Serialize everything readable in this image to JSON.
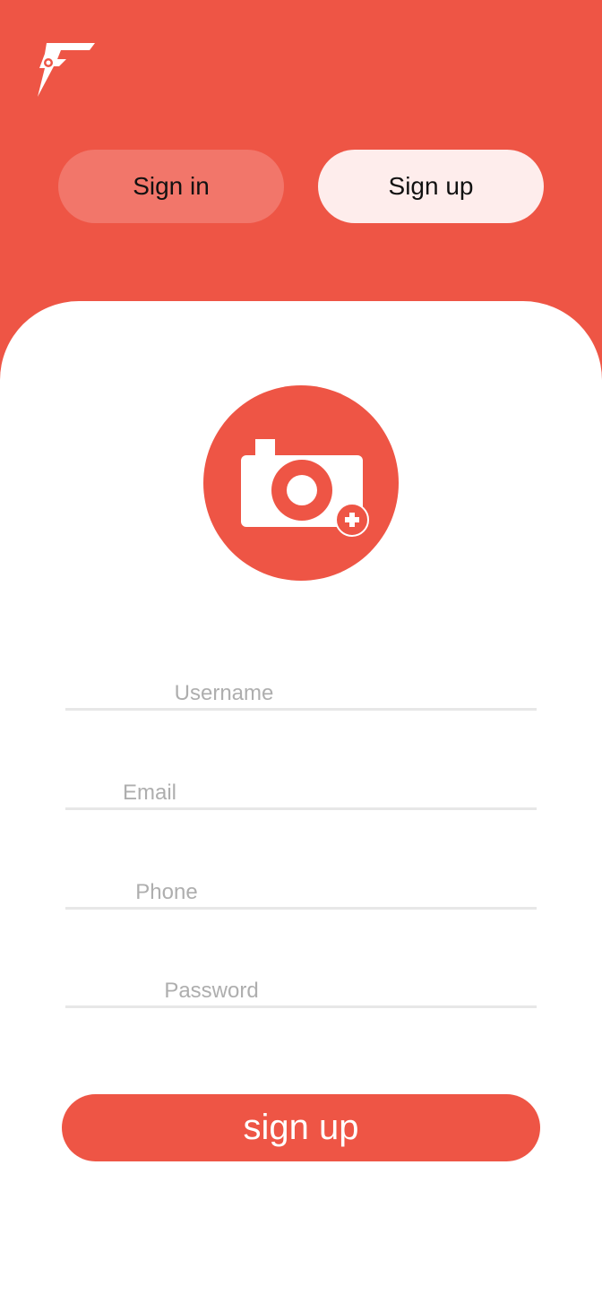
{
  "colors": {
    "brand": "#EE5545",
    "tab_inactive": "#F2766A",
    "tab_active": "#FEEDEC",
    "placeholder": "#AEAEAE",
    "divider": "#E7E7E7"
  },
  "header": {
    "logo_icon": "lightning-f-logo-icon"
  },
  "tabs": [
    {
      "label": "Sign in",
      "active": false
    },
    {
      "label": "Sign up",
      "active": true
    }
  ],
  "avatar": {
    "icon": "camera-add-icon"
  },
  "form": {
    "username": {
      "placeholder": "Username",
      "value": ""
    },
    "email": {
      "placeholder": "Email",
      "value": ""
    },
    "phone": {
      "placeholder": "Phone",
      "value": ""
    },
    "password": {
      "placeholder": "Password",
      "value": ""
    }
  },
  "submit": {
    "label": "sign up"
  }
}
